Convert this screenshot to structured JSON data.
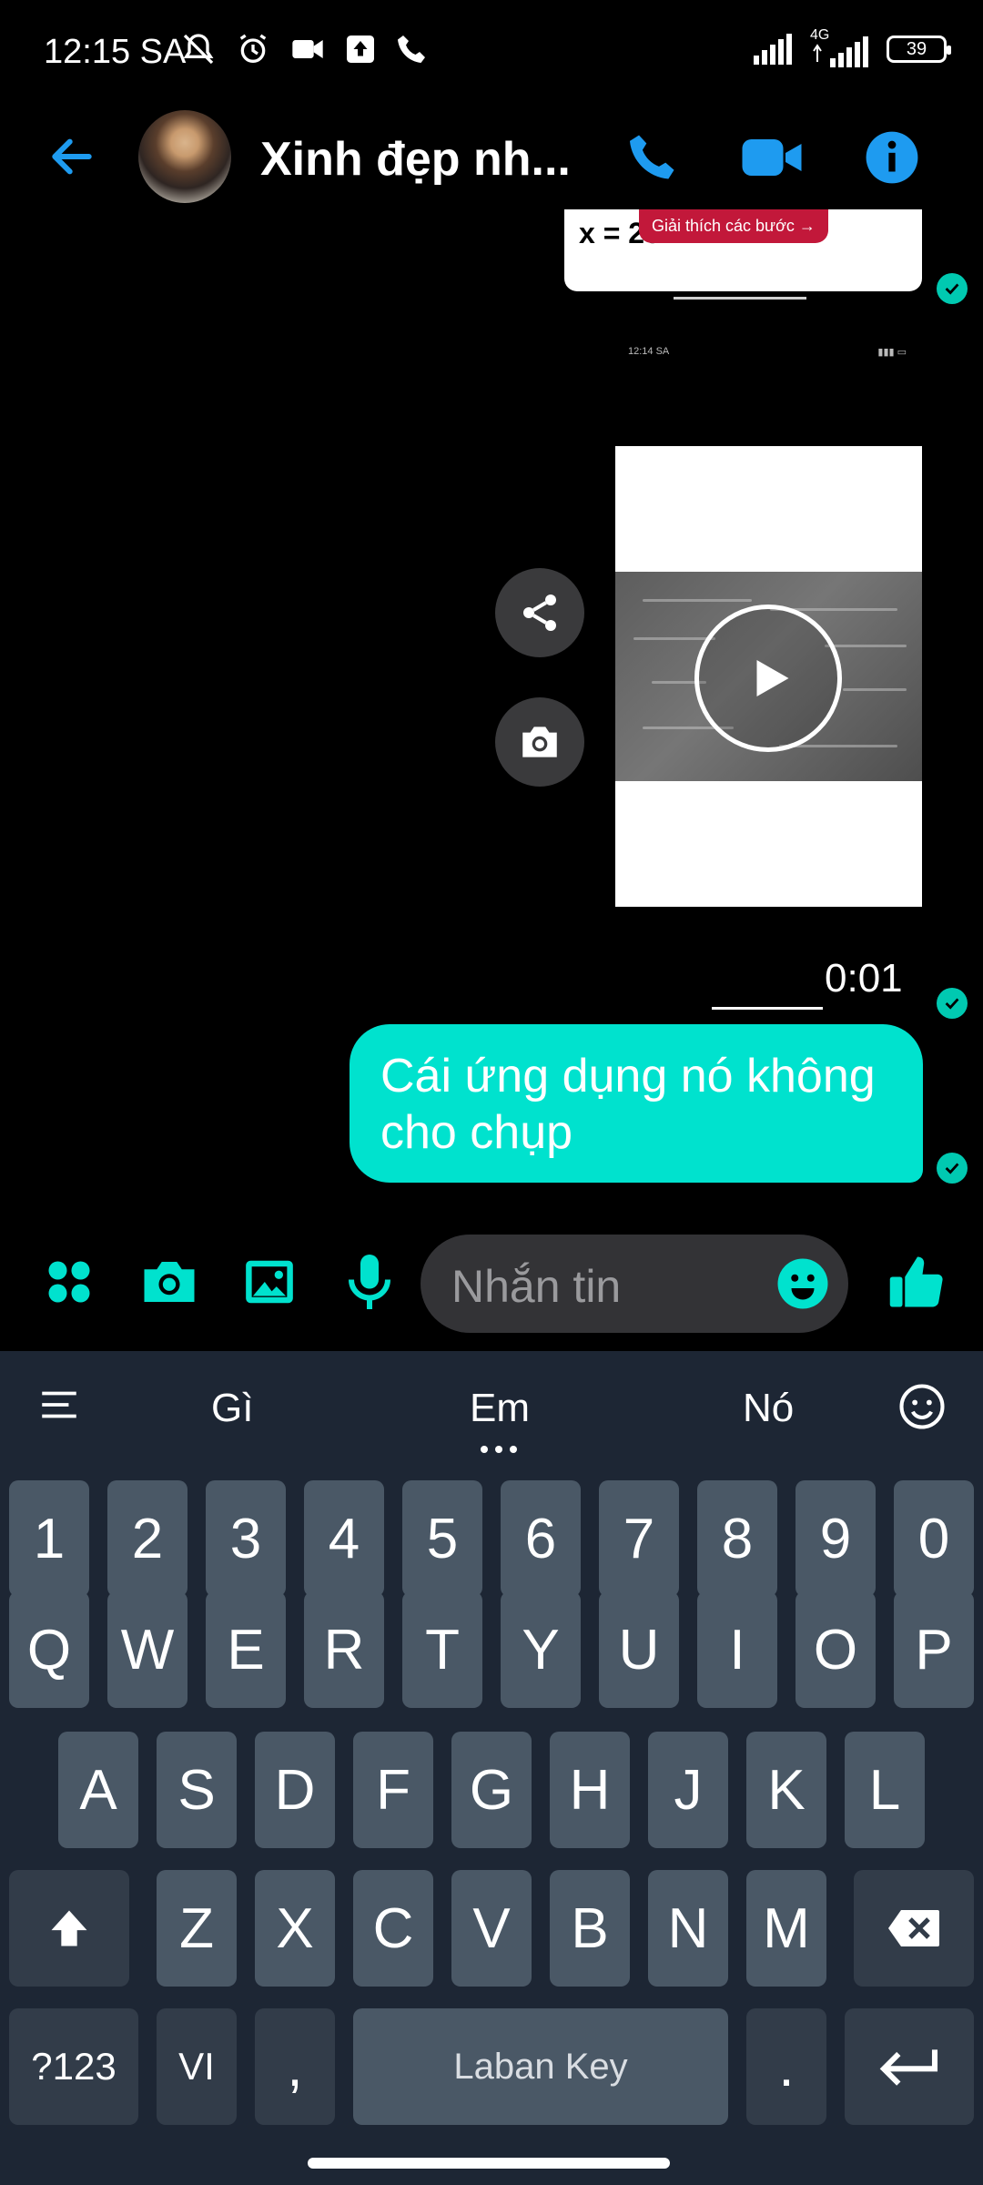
{
  "status_bar": {
    "time": "12:15 SA",
    "network": "4G",
    "battery": "39"
  },
  "header": {
    "contact_name": "Xinh đẹp nh..."
  },
  "chat": {
    "screenshot_msg": {
      "x_text": "x = 20",
      "pill_text": "Giải thích các bước",
      "status_time": "12:14 SA"
    },
    "video_duration": "0:01",
    "sent_message": "Cái ứng dụng nó không cho chụp"
  },
  "composer": {
    "placeholder": "Nhắn tin"
  },
  "keyboard": {
    "suggestions": [
      "Gì",
      "Em",
      "Nó"
    ],
    "number_row": [
      "1",
      "2",
      "3",
      "4",
      "5",
      "6",
      "7",
      "8",
      "9",
      "0"
    ],
    "row1": [
      "Q",
      "W",
      "E",
      "R",
      "T",
      "Y",
      "U",
      "I",
      "O",
      "P"
    ],
    "row2": [
      "A",
      "S",
      "D",
      "F",
      "G",
      "H",
      "J",
      "K",
      "L"
    ],
    "row3": [
      "Z",
      "X",
      "C",
      "V",
      "B",
      "N",
      "M"
    ],
    "symbols_key": "?123",
    "lang_key": "VI",
    "comma_key": ",",
    "space_key": "Laban Key",
    "period_key": "."
  },
  "colors": {
    "accent": "#1e9bf0",
    "teal": "#00e2ce",
    "keyboard_bg": "#1d2634",
    "key_bg": "#4a5866"
  }
}
